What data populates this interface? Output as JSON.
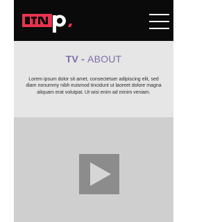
{
  "header": {
    "logo_text": "ITNp.",
    "menu_icon": "hamburger-menu-icon"
  },
  "about": {
    "title_tv": "TV",
    "title_sep": " - ",
    "title_about": "ABOUT",
    "body": "Lorem ipsum dolor sit amet, consectetuer adipiscing elit, sed diam nonummy nibh euismod tincidunt ut laoreet dolore magna aliquam erat volutpat. Ut wisi enim ad minim veniam."
  },
  "video": {
    "play_icon": "play-icon"
  },
  "colors": {
    "accent_red": "#e8334f",
    "title_purple": "#7e6ca8",
    "header_bg": "#0a0a0a"
  }
}
